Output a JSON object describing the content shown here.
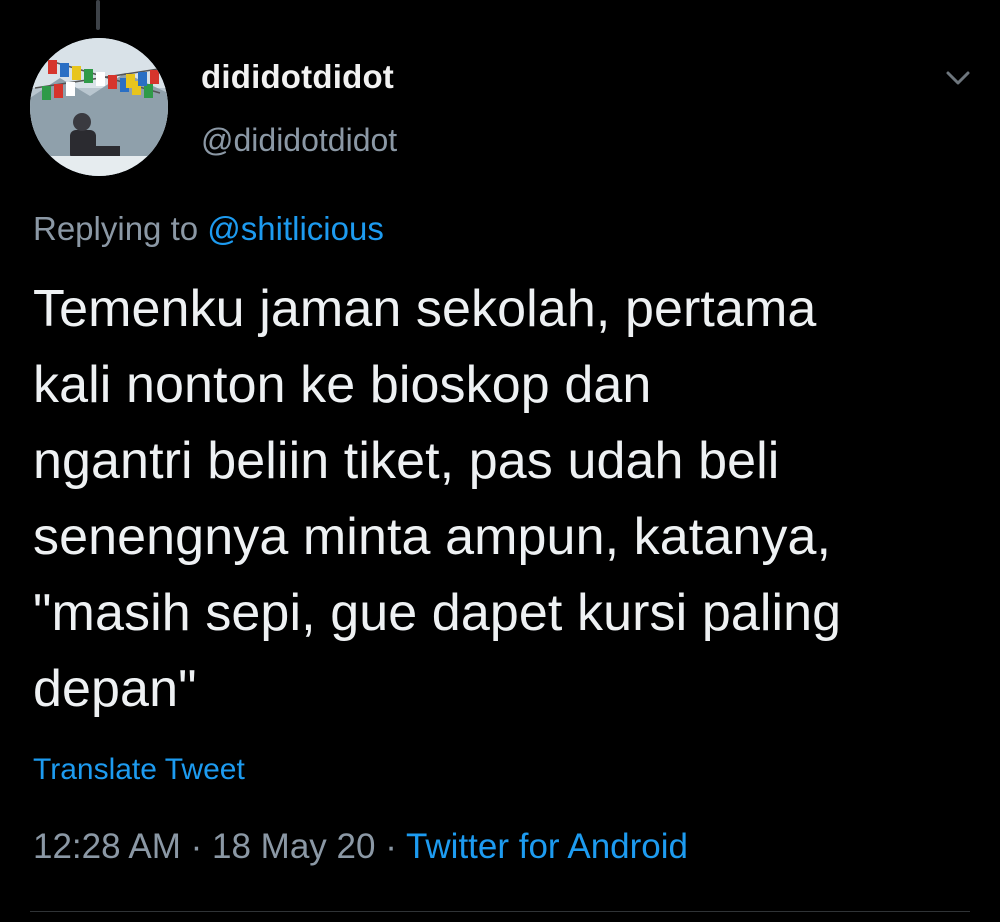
{
  "tweet": {
    "author": {
      "display_name": "dididotdidot",
      "handle": "@dididotdidot",
      "avatar_icon": "avatar-photo"
    },
    "reply": {
      "prefix": "Replying to",
      "mention": "@shitlicious"
    },
    "text_lines": [
      "Temenku jaman sekolah, pertama",
      "kali nonton ke bioskop dan",
      "ngantri beliin tiket, pas udah beli",
      "senengnya minta ampun, katanya,",
      "\"masih sepi, gue dapet kursi paling",
      "depan\""
    ],
    "translate_label": "Translate Tweet",
    "meta": {
      "time": "12:28 AM",
      "date": "18 May 20",
      "separator": "·",
      "source": "Twitter for Android"
    },
    "menu_icon": "chevron-down-icon"
  },
  "colors": {
    "background": "#000000",
    "link": "#1d9bf0",
    "secondary_text": "#8b98a5",
    "primary_text": "#eef1f3"
  }
}
